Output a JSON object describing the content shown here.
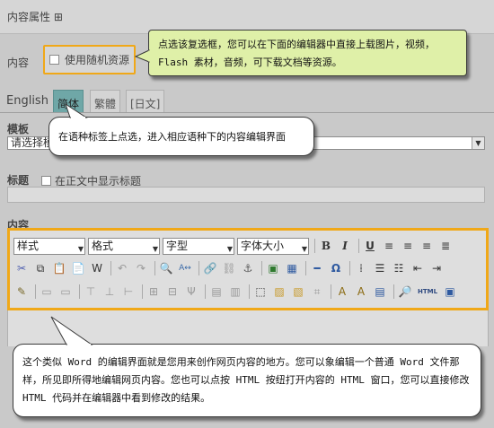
{
  "header": {
    "title": "内容属性 ⊞"
  },
  "content_row": {
    "label": "内容",
    "random_resource_label": "使用随机资源"
  },
  "tabs": [
    {
      "label": "English",
      "active": false
    },
    {
      "label": "简体",
      "active": true
    },
    {
      "label": "繁體",
      "active": false
    },
    {
      "label": "[日文]",
      "active": false
    }
  ],
  "template": {
    "label": "模板",
    "select_value": "请选择模"
  },
  "title_section": {
    "label": "标题",
    "show_title_label": "在正文中显示标题"
  },
  "editor": {
    "label": "内容",
    "dropdowns": [
      "样式",
      "格式",
      "字型",
      "字体大小"
    ],
    "html_label": "HTML"
  },
  "callouts": {
    "random": "点选该复选框，您可以在下面的编辑器中直接上载图片，视频，Flash 素材，音频，可下载文档等资源。",
    "language": "在语种标签上点选，进入相应语种下的内容编辑界面",
    "editor": "这个类似 Word 的编辑界面就是您用来创作网页内容的地方。您可以象编辑一个普通 Word 文件那样，所见即所得地编辑网页内容。您也可以点按 HTML 按纽打开内容的 HTML 窗口，您可以直接修改 HTML 代码并在编辑器中看到修改的结果。"
  },
  "colors": {
    "highlight": "#f0a818",
    "callout_green": "#dff0a8",
    "active_tab": "#6fa7a7"
  }
}
